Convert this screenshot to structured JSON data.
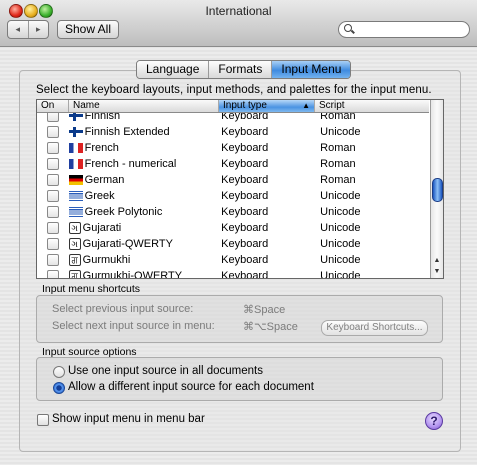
{
  "window": {
    "title": "International"
  },
  "toolbar": {
    "back_icon": "◂",
    "forward_icon": "▸",
    "show_all_label": "Show All",
    "search_value": ""
  },
  "tabs": [
    {
      "label": "Language",
      "active": false
    },
    {
      "label": "Formats",
      "active": false
    },
    {
      "label": "Input Menu",
      "active": true
    }
  ],
  "instruction": "Select the keyboard layouts, input methods, and palettes for the input menu.",
  "table": {
    "headers": {
      "on": "On",
      "name": "Name",
      "type": "Input type",
      "script": "Script",
      "sort_icon": "▲"
    },
    "rows": [
      {
        "name": "Finnish",
        "type": "Keyboard",
        "script": "Roman",
        "flag": "fi",
        "checked": false
      },
      {
        "name": "Finnish Extended",
        "type": "Keyboard",
        "script": "Unicode",
        "flag": "fi",
        "checked": false
      },
      {
        "name": "French",
        "type": "Keyboard",
        "script": "Roman",
        "flag": "fr",
        "checked": false
      },
      {
        "name": "French - numerical",
        "type": "Keyboard",
        "script": "Roman",
        "flag": "fr",
        "checked": false
      },
      {
        "name": "German",
        "type": "Keyboard",
        "script": "Roman",
        "flag": "de",
        "checked": false
      },
      {
        "name": "Greek",
        "type": "Keyboard",
        "script": "Unicode",
        "flag": "gr",
        "checked": false
      },
      {
        "name": "Greek Polytonic",
        "type": "Keyboard",
        "script": "Unicode",
        "flag": "gr",
        "checked": false
      },
      {
        "name": "Gujarati",
        "type": "Keyboard",
        "script": "Unicode",
        "flag": "gujarati",
        "checked": false
      },
      {
        "name": "Gujarati-QWERTY",
        "type": "Keyboard",
        "script": "Unicode",
        "flag": "gujarati",
        "checked": false
      },
      {
        "name": "Gurmukhi",
        "type": "Keyboard",
        "script": "Unicode",
        "flag": "gurmukhi",
        "checked": false
      },
      {
        "name": "Gurmukhi-QWERTY",
        "type": "Keyboard",
        "script": "Unicode",
        "flag": "gurmukhi",
        "checked": false
      }
    ]
  },
  "shortcuts": {
    "heading": "Input menu shortcuts",
    "prev_label": "Select previous input source:",
    "prev_keys": "⌘Space",
    "next_label": "Select next input source in menu:",
    "next_keys": "⌘⌥Space",
    "button_label": "Keyboard Shortcuts..."
  },
  "options": {
    "heading": "Input source options",
    "one_source": "Use one input source in all documents",
    "per_document": "Allow a different input source for each document",
    "selected": "per_document"
  },
  "bottom": {
    "show_menu_label": "Show input menu in menu bar",
    "help_label": "?"
  }
}
